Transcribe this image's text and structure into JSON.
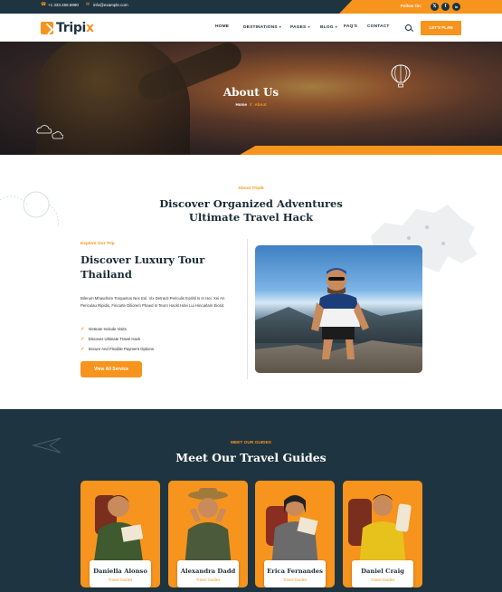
{
  "colors": {
    "accent": "#f7941d",
    "dark": "#1f3441"
  },
  "topbar": {
    "phone": "+1 333.456.6890",
    "email": "info@example.com",
    "follow_label": "Follow On:",
    "social": [
      {
        "icon": "x-icon",
        "glyph": "𝕏"
      },
      {
        "icon": "facebook-icon",
        "glyph": "f"
      },
      {
        "icon": "linkedin-icon",
        "glyph": "in"
      }
    ]
  },
  "header": {
    "logo_main": "Tripi",
    "logo_accent": "x",
    "nav": [
      "HOME",
      "DESTINATIONS",
      "PAGES",
      "BLOG",
      "FAQ'S",
      "CONTACT"
    ],
    "cta": "LET'S PLAN"
  },
  "hero": {
    "title": "About Us",
    "breadcrumb_home": "Home",
    "breadcrumb_sep": "//",
    "breadcrumb_current": "About"
  },
  "about": {
    "kicker": "About Tripib",
    "title_line1": "Discover Organized Adventures",
    "title_line2": "Ultimate Travel Hack",
    "explore": "Explore Our Trip",
    "tour_title_line1": "Discover Luxury Tour",
    "tour_title_line2": "Thailand",
    "paragraph": "Bilerum Mhavdrum Torqueitos Nex Eul. Vix Detracti Periculis Eosltil Is In Hei. Xei An Periculau Ripidis, Fincarte Diliorem Phaed Is Teurn Hackl Hdei Lui Hincarlam Eiosit.",
    "checks": [
      "Vietnam Include Visits",
      "Discover Ultimate Travel Hack",
      "Secure And Flexible Payment Options"
    ],
    "button": "View All Service"
  },
  "guides": {
    "kicker": "MEET OUR GUIDES",
    "title": "Meet Our Travel Guides",
    "cards": [
      {
        "name": "Daniella Alonso",
        "role": "Travel Guides"
      },
      {
        "name": "Alexandra Dadd",
        "role": "Travel Guides"
      },
      {
        "name": "Erica Fernandes",
        "role": "Travel Guides"
      },
      {
        "name": "Daniel Craig",
        "role": "Travel Guides"
      }
    ]
  }
}
